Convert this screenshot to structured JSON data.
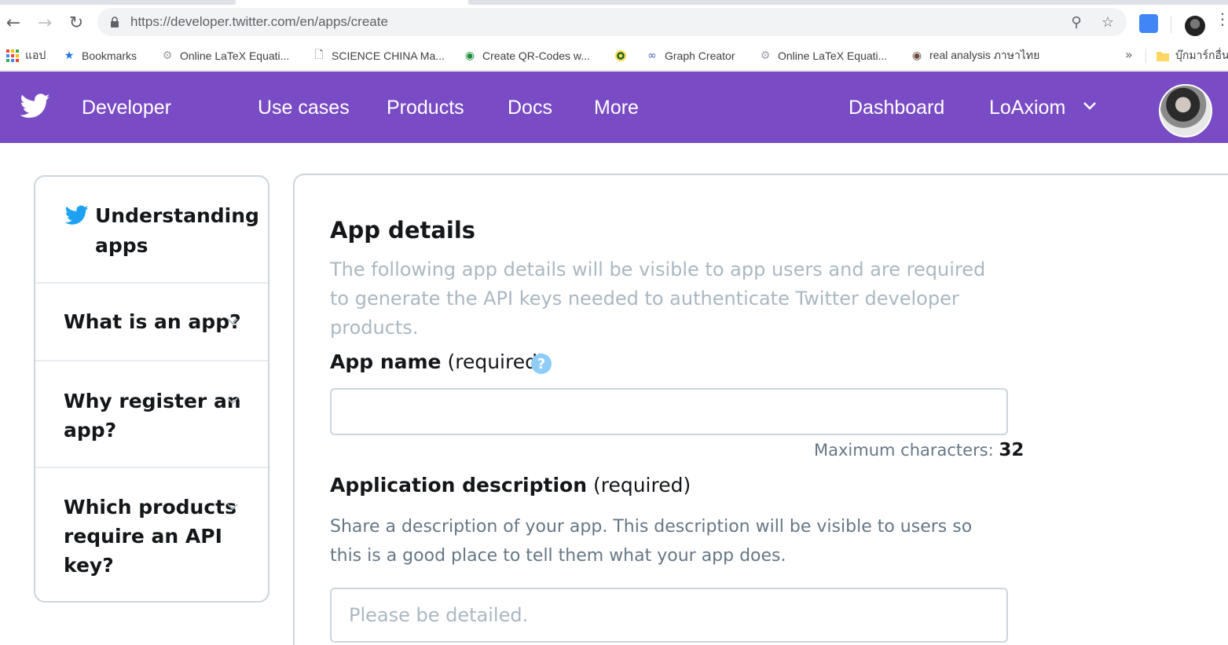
{
  "browser": {
    "url": "https://developer.twitter.com/en/apps/create",
    "bookmarks": [
      {
        "label": "แอป",
        "icon": "apps-grid-icon"
      },
      {
        "label": "Bookmarks",
        "icon": "star-icon"
      },
      {
        "label": "Online LaTeX Equati...",
        "icon": "gear-icon"
      },
      {
        "label": "SCIENCE CHINA Ma...",
        "icon": "page-icon"
      },
      {
        "label": "Create QR-Codes w...",
        "icon": "qr-icon"
      },
      {
        "label": "",
        "icon": "circle-logo-icon"
      },
      {
        "label": "Graph Creator",
        "icon": "graph-icon"
      },
      {
        "label": "Online LaTeX Equati...",
        "icon": "gear-icon"
      },
      {
        "label": "real analysis ภาษาไทย",
        "icon": "owl-icon"
      },
      {
        "label": "บุ๊กมาร์กอื่น",
        "icon": "folder-icon"
      }
    ],
    "more_glyph": "»"
  },
  "nav": {
    "brand": "Developer",
    "links": [
      "Use cases",
      "Products",
      "Docs",
      "More"
    ],
    "dashboard": "Dashboard",
    "user": "LoAxiom",
    "brand_color": "#794bc4"
  },
  "sidebar": {
    "sections": [
      {
        "title_line1": "Understanding",
        "title_line2": "apps"
      },
      {
        "title": "What is an app?"
      },
      {
        "title_line1": "Why register an",
        "title_line2": "app?"
      },
      {
        "title_line1": "Which products",
        "title_line2": "require an API",
        "title_line3": "key?"
      }
    ]
  },
  "main": {
    "title": "App details",
    "lead": "The following app details will be visible to app users and are required to generate the API keys needed to authenticate Twitter developer products.",
    "app_name": {
      "label": "App name",
      "req": "(required)",
      "help": "?",
      "value": "",
      "max_prefix": "Maximum characters:",
      "max_value": "32"
    },
    "description": {
      "label": "Application description",
      "req": "(required)",
      "help_text": "Share a description of your app. This description will be visible to users so this is a good place to tell them what your app does.",
      "placeholder": "Please be detailed."
    }
  }
}
